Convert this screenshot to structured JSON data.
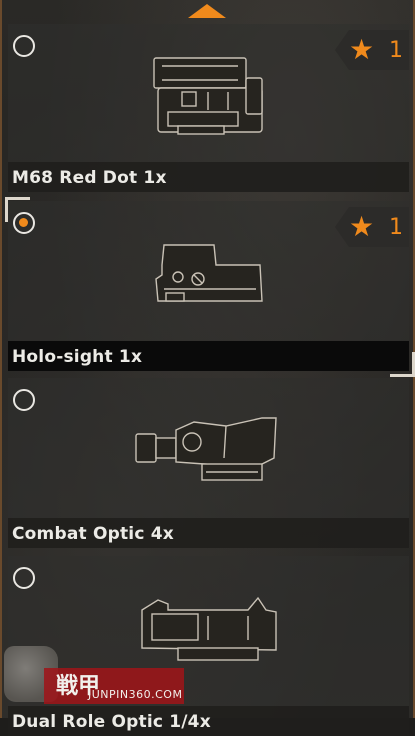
{
  "items": [
    {
      "label": "M68 Red Dot 1x",
      "selected": false,
      "favorite": true,
      "star_count": "1",
      "icon": "m68-red-dot-scope-icon"
    },
    {
      "label": "Holo-sight 1x",
      "selected": true,
      "favorite": true,
      "star_count": "1",
      "icon": "holo-sight-scope-icon"
    },
    {
      "label": "Combat Optic 4x",
      "selected": false,
      "favorite": false,
      "icon": "combat-optic-scope-icon"
    },
    {
      "label": "Dual Role Optic 1/4x",
      "selected": false,
      "favorite": false,
      "icon": "dual-role-optic-scope-icon"
    }
  ],
  "badge_star_glyph": "★",
  "watermark": {
    "brand": "戦甲",
    "url": "JUNPIN360.COM"
  },
  "colors": {
    "accent": "#f08a1c",
    "text": "#ecebe6",
    "selected_bar": "#080808"
  }
}
